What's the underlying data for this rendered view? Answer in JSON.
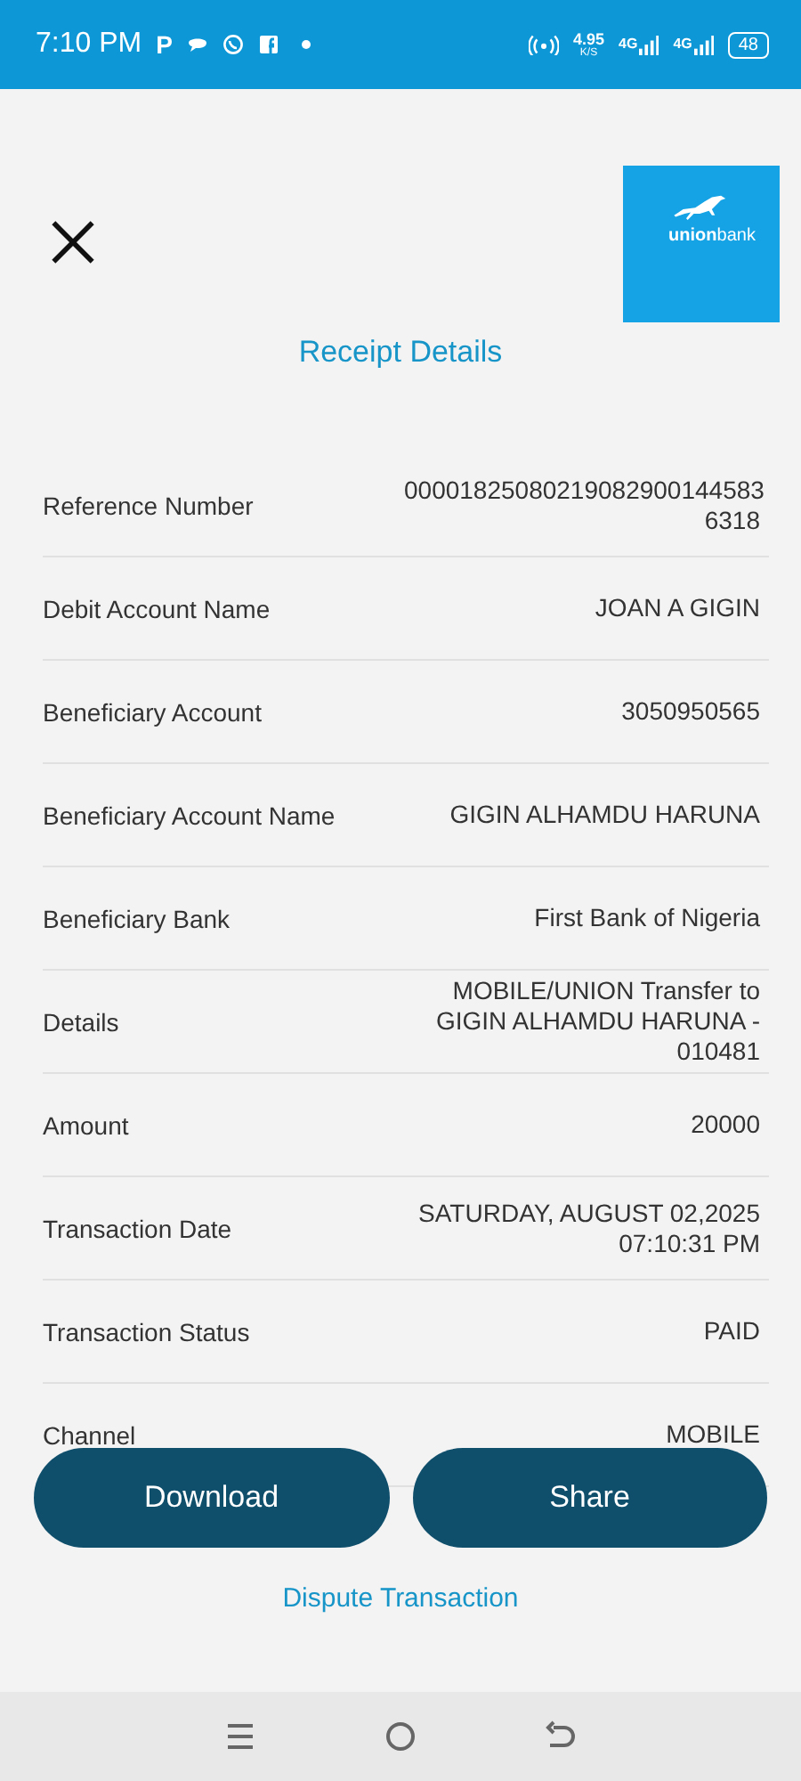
{
  "status_bar": {
    "time": "7:10 PM",
    "notification_letter": "P",
    "speed": "4.95",
    "speed_unit": "K/S",
    "network_1": "4G",
    "network_2": "4G",
    "battery": "48"
  },
  "header": {
    "logo_text_bold": "union",
    "logo_text": "bank",
    "title": "Receipt Details"
  },
  "rows": [
    {
      "label": "Reference Number",
      "value": "00001825080219082900144583 6318"
    },
    {
      "label": "Debit Account Name",
      "value": "JOAN A GIGIN"
    },
    {
      "label": "Beneficiary Account",
      "value": "3050950565"
    },
    {
      "label": "Beneficiary Account Name",
      "value": "GIGIN ALHAMDU HARUNA"
    },
    {
      "label": "Beneficiary Bank",
      "value": "First Bank of Nigeria"
    },
    {
      "label": "Details",
      "value": "MOBILE/UNION Transfer to GIGIN ALHAMDU HARUNA - 010481"
    },
    {
      "label": "Amount",
      "value": "20000"
    },
    {
      "label": "Transaction Date",
      "value": "SATURDAY, AUGUST 02,2025 07:10:31 PM"
    },
    {
      "label": "Transaction Status",
      "value": "PAID"
    },
    {
      "label": "Channel",
      "value": "MOBILE"
    }
  ],
  "buttons": [
    "Download",
    "Share"
  ],
  "dispute_link": "Dispute Transaction"
}
